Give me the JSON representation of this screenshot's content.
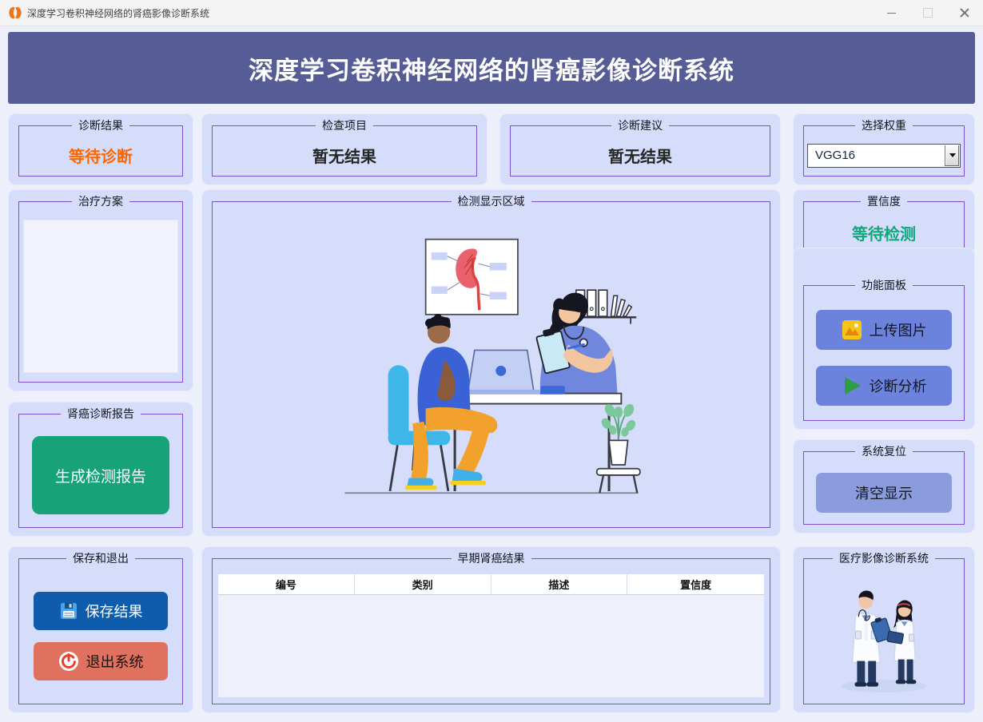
{
  "window": {
    "title": "深度学习卷积神经网络的肾癌影像诊断系统"
  },
  "header": {
    "title": "深度学习卷积神经网络的肾癌影像诊断系统"
  },
  "panels": {
    "diagnosis_result": {
      "legend": "诊断结果",
      "value": "等待诊断"
    },
    "check_item": {
      "legend": "检查项目",
      "value": "暂无结果"
    },
    "diagnosis_advice": {
      "legend": "诊断建议",
      "value": "暂无结果"
    },
    "weight_select": {
      "legend": "选择权重",
      "selected": "VGG16"
    },
    "treatment_plan": {
      "legend": "治疗方案",
      "value": ""
    },
    "report": {
      "legend": "肾癌诊断报告",
      "button": "生成检测报告"
    },
    "save_exit": {
      "legend": "保存和退出",
      "save_button": "保存结果",
      "exit_button": "退出系统"
    },
    "display_area": {
      "legend": "检测显示区域"
    },
    "results_table": {
      "legend": "早期肾癌结果",
      "columns": [
        "编号",
        "类别",
        "描述",
        "置信度"
      ],
      "rows": []
    },
    "confidence": {
      "legend": "置信度",
      "value": "等待检测"
    },
    "function_panel": {
      "legend": "功能面板",
      "upload_button": "上传图片",
      "analyze_button": "诊断分析"
    },
    "system_reset": {
      "legend": "系统复位",
      "clear_button": "清空显示"
    },
    "branding": {
      "legend": "医疗影像诊断系统"
    }
  },
  "icons": {
    "app": "kidneys-icon",
    "save": "floppy-disk-icon",
    "exit": "power-icon",
    "upload": "image-icon",
    "analyze": "play-icon",
    "combo": "dropdown-arrow-icon"
  },
  "colors": {
    "banner": "#565c95",
    "panel": "#d5ddfa",
    "groupbox_border": "#7e4fd0",
    "waiting_orange": "#ff6600",
    "waiting_green": "#0fa87b",
    "report_green": "#17a277",
    "save_blue": "#0f5cad",
    "exit_salmon": "#e0715e",
    "func_blue": "#6b83dc",
    "clear_blue": "#8b9cdd"
  }
}
